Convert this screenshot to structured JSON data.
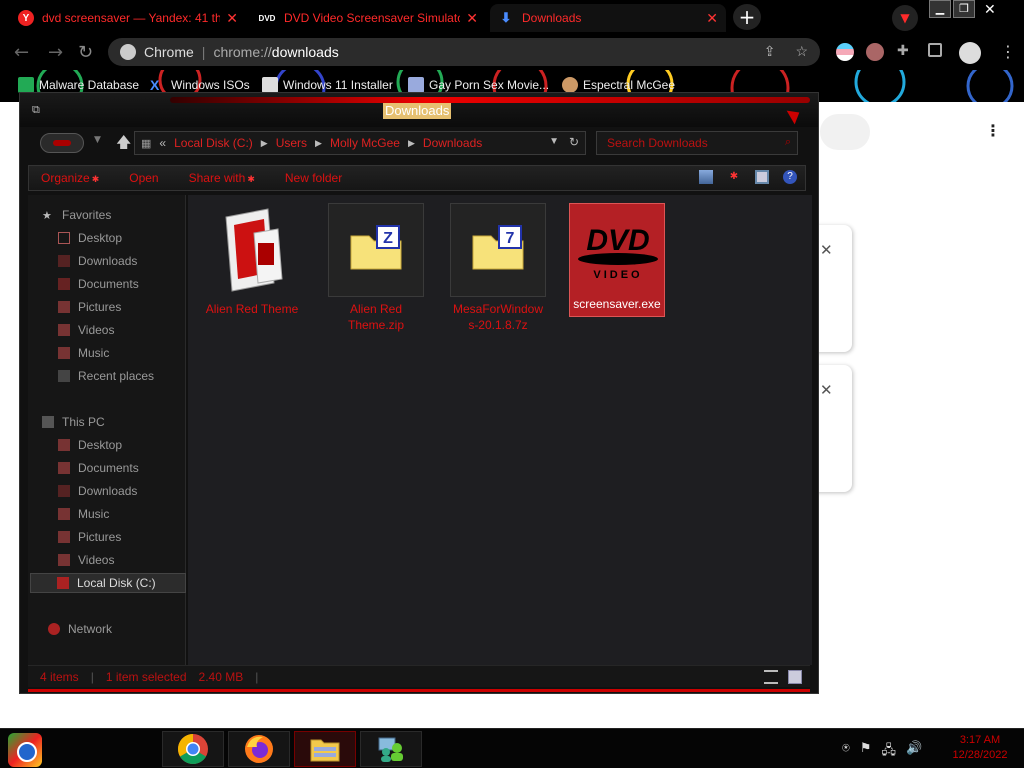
{
  "browser": {
    "tabs": [
      {
        "title": "dvd screensaver — Yandex: 41 th",
        "favicon": "yandex-icon"
      },
      {
        "title": "DVD Video Screensaver Simulato",
        "favicon": "dvd-icon"
      },
      {
        "title": "Downloads",
        "favicon": "download-icon",
        "active": true
      }
    ],
    "new_tab_label": "+",
    "omnibox": {
      "site_label": "Chrome",
      "scheme": "chrome://",
      "host": "downloads"
    },
    "bookmarks": [
      {
        "label": "Malware Database",
        "icon": "cross-icon"
      },
      {
        "label": "Windows ISOs",
        "icon": "x-icon"
      },
      {
        "label": "Windows 11 Installer",
        "icon": "windows-icon"
      },
      {
        "label": "Gay Porn Sex Movie...",
        "icon": "penguin-icon"
      },
      {
        "label": "Espectral McGee",
        "icon": "face-icon"
      }
    ]
  },
  "explorer": {
    "title": "Downloads",
    "breadcrumb": [
      "Local Disk (C:)",
      "Users",
      "Molly McGee",
      "Downloads"
    ],
    "breadcrumb_overflow": "«",
    "search_placeholder": "Search Downloads",
    "commands": [
      "Organize",
      "Open",
      "Share with",
      "New folder"
    ],
    "nav": {
      "favorites_header": "Favorites",
      "favorites": [
        "Desktop",
        "Downloads",
        "Documents",
        "Pictures",
        "Videos",
        "Music",
        "Recent places"
      ],
      "thispc_header": "This PC",
      "thispc": [
        "Desktop",
        "Documents",
        "Downloads",
        "Music",
        "Pictures",
        "Videos",
        "Local Disk (C:)"
      ],
      "network": "Network"
    },
    "files": [
      {
        "name": "Alien Red Theme",
        "type": "theme"
      },
      {
        "name": "Alien Red Theme.zip",
        "type": "zip"
      },
      {
        "name": "MesaForWindows-20.1.8.7z",
        "type": "7z"
      },
      {
        "name": "screensaver.exe",
        "type": "exe",
        "selected": true
      }
    ],
    "file_labels": {
      "f0": "Alien Red Theme",
      "f1_l1": "Alien Red",
      "f1_l2": "Theme.zip",
      "f2_l1": "MesaForWindow",
      "f2_l2": "s-20.1.8.7z",
      "f3": "screensaver.exe"
    },
    "dvd_logo": {
      "top": "DVD",
      "bottom": "VIDEO"
    },
    "status": {
      "item_count": "4 items",
      "selection": "1 item selected",
      "size": "2.40 MB"
    }
  },
  "taskbar": {
    "apps": [
      "chrome-icon",
      "firefox-icon",
      "file-explorer-icon",
      "network-people-icon"
    ],
    "clock_time": "3:17 AM",
    "clock_date": "12/28/2022"
  },
  "colors": {
    "accent_red": "#d11111",
    "selection_red": "#b42025",
    "window_bg": "#1e1e21"
  }
}
